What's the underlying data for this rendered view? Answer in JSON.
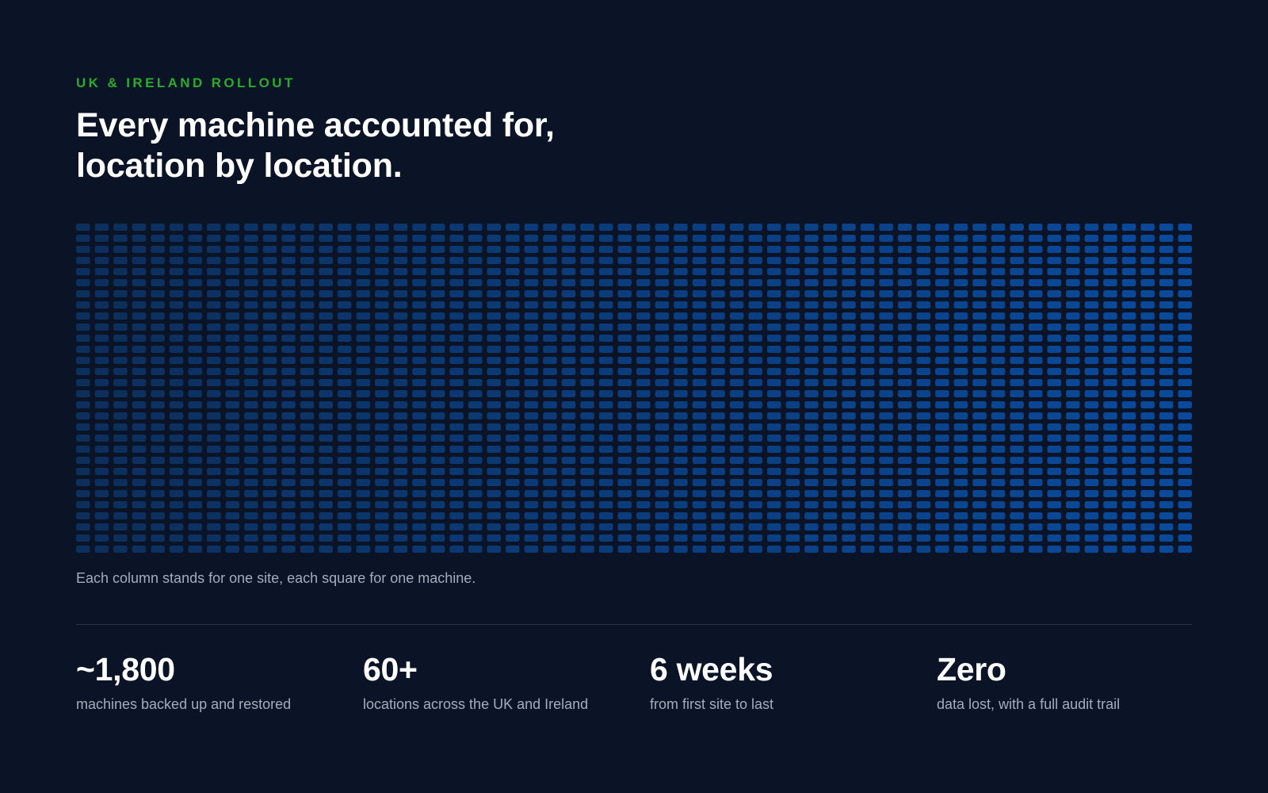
{
  "header": {
    "eyebrow": "UK & IRELAND ROLLOUT",
    "headline_line1": "Every machine accounted for,",
    "headline_line2": "location by location."
  },
  "grid": {
    "caption": "Each column stands for one site, each square for one machine.",
    "columns": 60,
    "rows": 30,
    "color_start": "#0c2f5c",
    "color_end": "#0a4a9c"
  },
  "stats": [
    {
      "value": "~1,800",
      "label": "machines backed up and restored"
    },
    {
      "value": "60+",
      "label": "locations across the UK and Ireland"
    },
    {
      "value": "6 weeks",
      "label": "from first site to last"
    },
    {
      "value": "Zero",
      "label": "data lost, with a full audit trail"
    }
  ]
}
